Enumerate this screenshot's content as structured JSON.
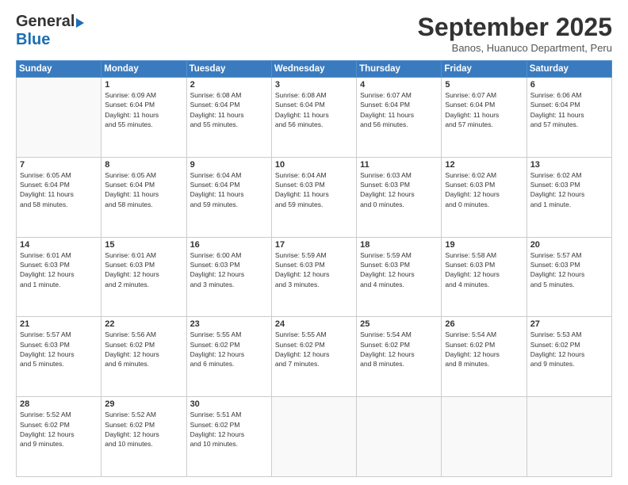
{
  "logo": {
    "general": "General",
    "blue": "Blue"
  },
  "header": {
    "month": "September 2025",
    "location": "Banos, Huanuco Department, Peru"
  },
  "days_of_week": [
    "Sunday",
    "Monday",
    "Tuesday",
    "Wednesday",
    "Thursday",
    "Friday",
    "Saturday"
  ],
  "weeks": [
    [
      {
        "day": "",
        "detail": ""
      },
      {
        "day": "1",
        "detail": "Sunrise: 6:09 AM\nSunset: 6:04 PM\nDaylight: 11 hours\nand 55 minutes."
      },
      {
        "day": "2",
        "detail": "Sunrise: 6:08 AM\nSunset: 6:04 PM\nDaylight: 11 hours\nand 55 minutes."
      },
      {
        "day": "3",
        "detail": "Sunrise: 6:08 AM\nSunset: 6:04 PM\nDaylight: 11 hours\nand 56 minutes."
      },
      {
        "day": "4",
        "detail": "Sunrise: 6:07 AM\nSunset: 6:04 PM\nDaylight: 11 hours\nand 56 minutes."
      },
      {
        "day": "5",
        "detail": "Sunrise: 6:07 AM\nSunset: 6:04 PM\nDaylight: 11 hours\nand 57 minutes."
      },
      {
        "day": "6",
        "detail": "Sunrise: 6:06 AM\nSunset: 6:04 PM\nDaylight: 11 hours\nand 57 minutes."
      }
    ],
    [
      {
        "day": "7",
        "detail": "Sunrise: 6:05 AM\nSunset: 6:04 PM\nDaylight: 11 hours\nand 58 minutes."
      },
      {
        "day": "8",
        "detail": "Sunrise: 6:05 AM\nSunset: 6:04 PM\nDaylight: 11 hours\nand 58 minutes."
      },
      {
        "day": "9",
        "detail": "Sunrise: 6:04 AM\nSunset: 6:04 PM\nDaylight: 11 hours\nand 59 minutes."
      },
      {
        "day": "10",
        "detail": "Sunrise: 6:04 AM\nSunset: 6:03 PM\nDaylight: 11 hours\nand 59 minutes."
      },
      {
        "day": "11",
        "detail": "Sunrise: 6:03 AM\nSunset: 6:03 PM\nDaylight: 12 hours\nand 0 minutes."
      },
      {
        "day": "12",
        "detail": "Sunrise: 6:02 AM\nSunset: 6:03 PM\nDaylight: 12 hours\nand 0 minutes."
      },
      {
        "day": "13",
        "detail": "Sunrise: 6:02 AM\nSunset: 6:03 PM\nDaylight: 12 hours\nand 1 minute."
      }
    ],
    [
      {
        "day": "14",
        "detail": "Sunrise: 6:01 AM\nSunset: 6:03 PM\nDaylight: 12 hours\nand 1 minute."
      },
      {
        "day": "15",
        "detail": "Sunrise: 6:01 AM\nSunset: 6:03 PM\nDaylight: 12 hours\nand 2 minutes."
      },
      {
        "day": "16",
        "detail": "Sunrise: 6:00 AM\nSunset: 6:03 PM\nDaylight: 12 hours\nand 3 minutes."
      },
      {
        "day": "17",
        "detail": "Sunrise: 5:59 AM\nSunset: 6:03 PM\nDaylight: 12 hours\nand 3 minutes."
      },
      {
        "day": "18",
        "detail": "Sunrise: 5:59 AM\nSunset: 6:03 PM\nDaylight: 12 hours\nand 4 minutes."
      },
      {
        "day": "19",
        "detail": "Sunrise: 5:58 AM\nSunset: 6:03 PM\nDaylight: 12 hours\nand 4 minutes."
      },
      {
        "day": "20",
        "detail": "Sunrise: 5:57 AM\nSunset: 6:03 PM\nDaylight: 12 hours\nand 5 minutes."
      }
    ],
    [
      {
        "day": "21",
        "detail": "Sunrise: 5:57 AM\nSunset: 6:03 PM\nDaylight: 12 hours\nand 5 minutes."
      },
      {
        "day": "22",
        "detail": "Sunrise: 5:56 AM\nSunset: 6:02 PM\nDaylight: 12 hours\nand 6 minutes."
      },
      {
        "day": "23",
        "detail": "Sunrise: 5:55 AM\nSunset: 6:02 PM\nDaylight: 12 hours\nand 6 minutes."
      },
      {
        "day": "24",
        "detail": "Sunrise: 5:55 AM\nSunset: 6:02 PM\nDaylight: 12 hours\nand 7 minutes."
      },
      {
        "day": "25",
        "detail": "Sunrise: 5:54 AM\nSunset: 6:02 PM\nDaylight: 12 hours\nand 8 minutes."
      },
      {
        "day": "26",
        "detail": "Sunrise: 5:54 AM\nSunset: 6:02 PM\nDaylight: 12 hours\nand 8 minutes."
      },
      {
        "day": "27",
        "detail": "Sunrise: 5:53 AM\nSunset: 6:02 PM\nDaylight: 12 hours\nand 9 minutes."
      }
    ],
    [
      {
        "day": "28",
        "detail": "Sunrise: 5:52 AM\nSunset: 6:02 PM\nDaylight: 12 hours\nand 9 minutes."
      },
      {
        "day": "29",
        "detail": "Sunrise: 5:52 AM\nSunset: 6:02 PM\nDaylight: 12 hours\nand 10 minutes."
      },
      {
        "day": "30",
        "detail": "Sunrise: 5:51 AM\nSunset: 6:02 PM\nDaylight: 12 hours\nand 10 minutes."
      },
      {
        "day": "",
        "detail": ""
      },
      {
        "day": "",
        "detail": ""
      },
      {
        "day": "",
        "detail": ""
      },
      {
        "day": "",
        "detail": ""
      }
    ]
  ]
}
